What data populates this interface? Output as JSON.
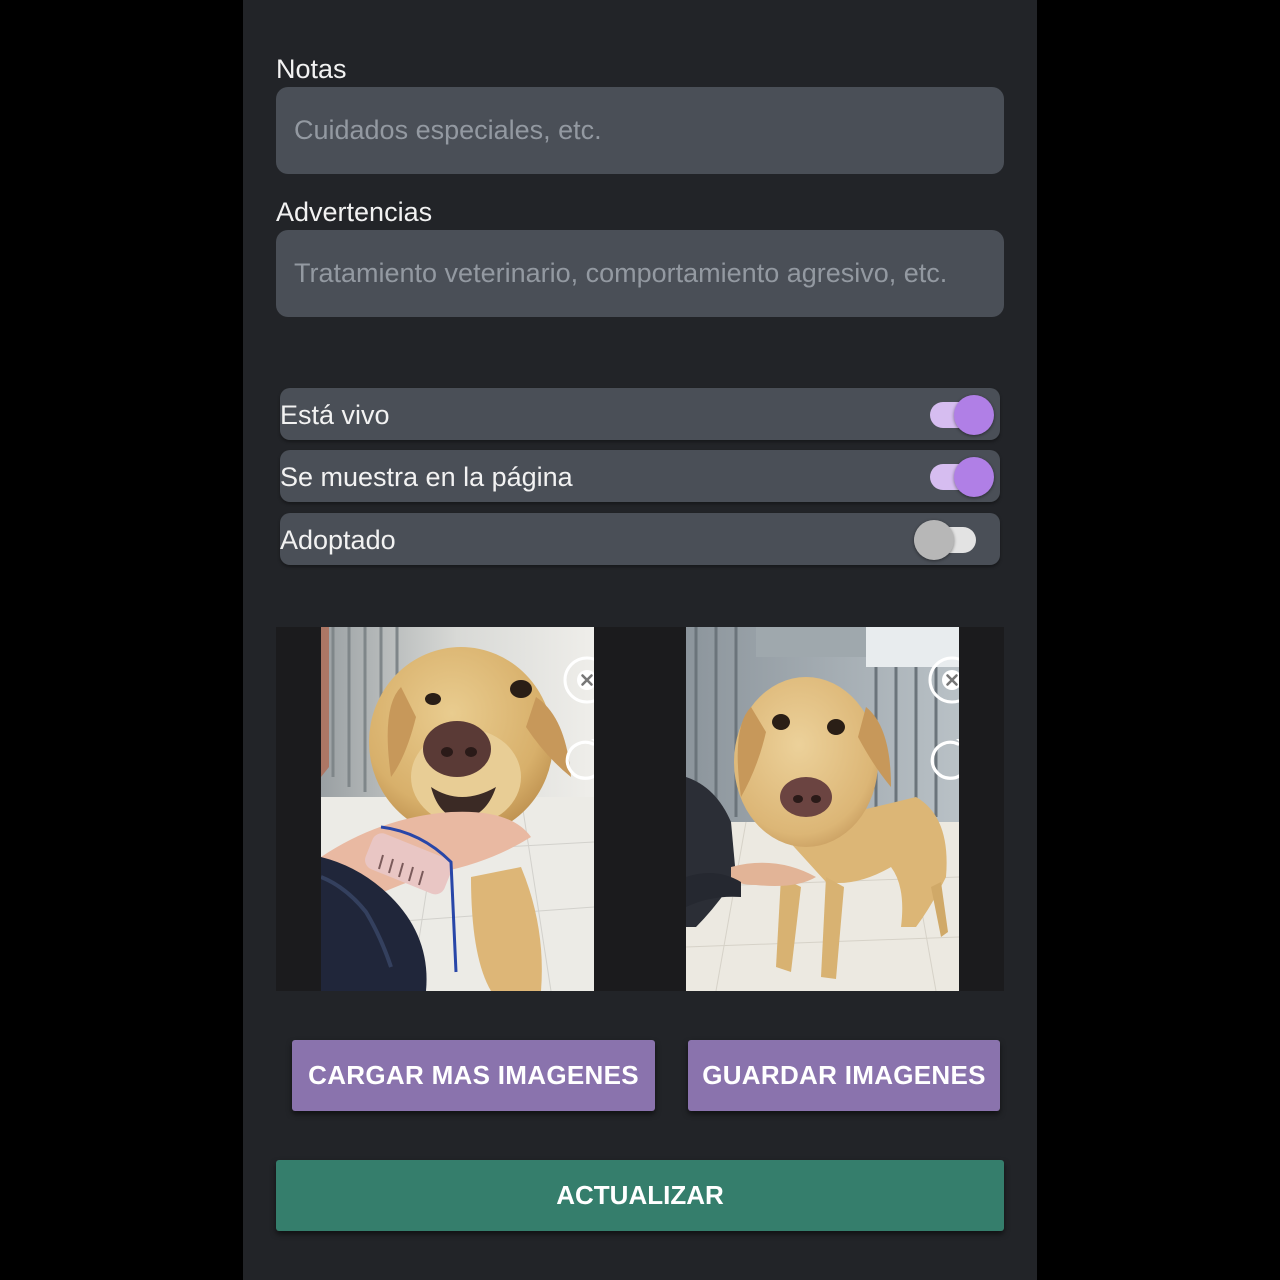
{
  "form": {
    "notes": {
      "label": "Notas",
      "placeholder": "Cuidados especiales, etc.",
      "value": ""
    },
    "warnings": {
      "label": "Advertencias",
      "placeholder": "Tratamiento veterinario, comportamiento agresivo, etc.",
      "value": ""
    }
  },
  "toggles": [
    {
      "label": "Está vivo",
      "checked": true
    },
    {
      "label": "Se muestra en la página",
      "checked": true
    },
    {
      "label": "Adoptado",
      "checked": false
    }
  ],
  "gallery": {
    "images": [
      {
        "icon": "dog-photo-1",
        "controls": [
          "remove-icon",
          "rotate-icon"
        ]
      },
      {
        "icon": "dog-photo-2",
        "controls": [
          "remove-icon",
          "rotate-icon"
        ]
      }
    ]
  },
  "buttons": {
    "load_more": "CARGAR MAS IMAGENES",
    "save_images": "GUARDAR IMAGENES",
    "update": "ACTUALIZAR"
  },
  "colors": {
    "panel_bg": "#222428",
    "field_bg": "#4a4f57",
    "toggle_on_thumb": "#b07fe6",
    "toggle_on_track": "#d6bdf0",
    "secondary_button": "#8a73ad",
    "primary_button": "#357e6c"
  }
}
